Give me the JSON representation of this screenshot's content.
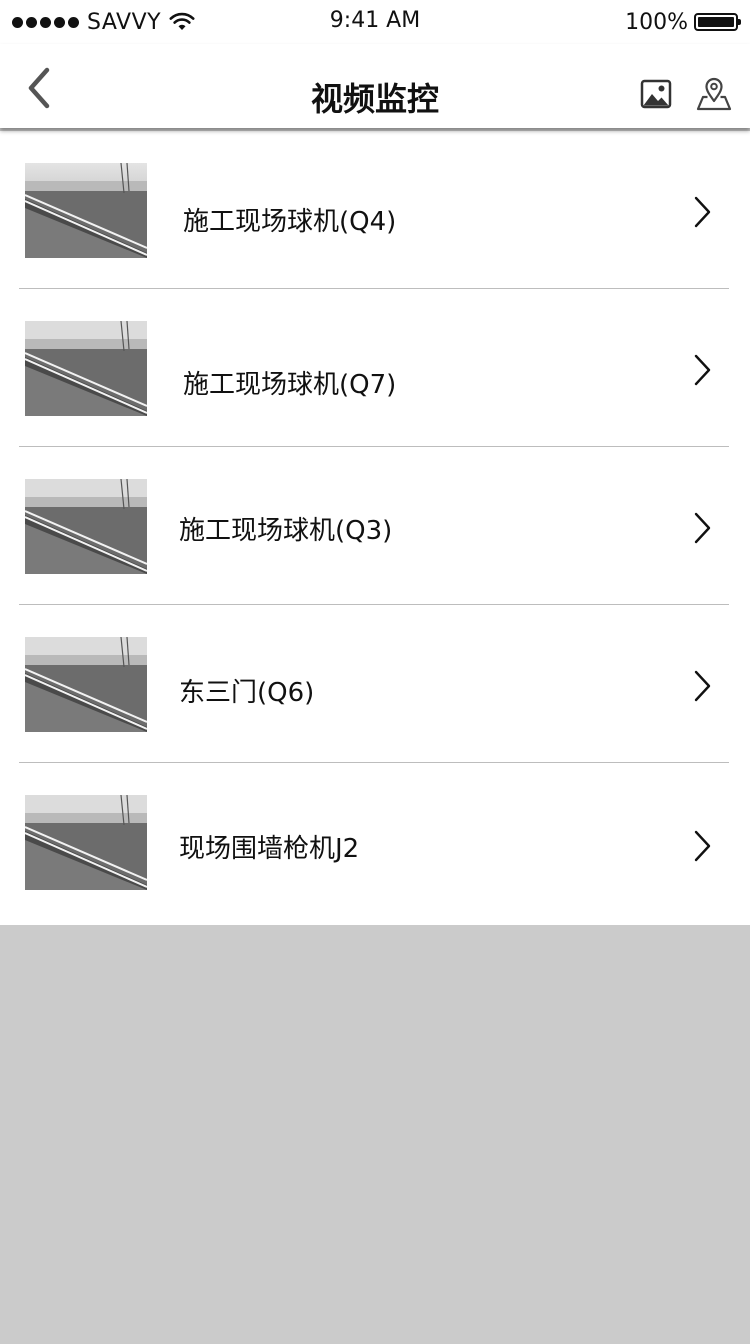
{
  "status_bar": {
    "carrier": "SAVVY",
    "time": "9:41 AM",
    "battery_percent": "100%"
  },
  "nav": {
    "title": "视频监控",
    "back_icon": "chevron-left-icon",
    "gallery_icon": "image-icon",
    "map_icon": "map-pin-icon"
  },
  "cameras": [
    {
      "label": "施工现场球机(Q4)"
    },
    {
      "label": "施工现场球机(Q7)"
    },
    {
      "label": "施工现场球机(Q3)"
    },
    {
      "label": "东三门(Q6)"
    },
    {
      "label": "现场围墙枪机J2"
    }
  ],
  "colors": {
    "background_empty": "#cbcbcb",
    "surface": "#ffffff",
    "divider": "#bdbdbd",
    "text": "#111111"
  }
}
